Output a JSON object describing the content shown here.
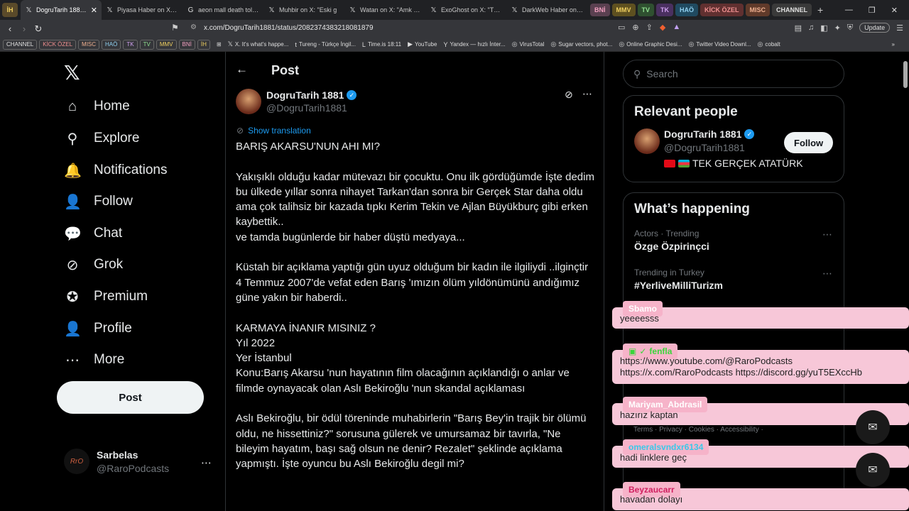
{
  "browser": {
    "tab_folder_left": "İH",
    "tabs": [
      {
        "icon": "𝕏",
        "title": "DogruTarih 1881 on X",
        "active": true
      },
      {
        "icon": "𝕏",
        "title": "Piyasa Haber on X: \"Jap",
        "active": false
      },
      {
        "icon": "G",
        "title": "aeon mall death toll - G",
        "active": false
      },
      {
        "icon": "𝕏",
        "title": "Muhbir on X: \"Eski g",
        "active": false
      },
      {
        "icon": "𝕏",
        "title": "Watan on X: \"Amk bu s",
        "active": false
      },
      {
        "icon": "𝕏",
        "title": "ExoGhost on X: \"The ne",
        "active": false
      },
      {
        "icon": "𝕏",
        "title": "DarkWeb Haber on X: \"",
        "active": false
      }
    ],
    "tab_groups": [
      {
        "label": "BNİ",
        "bg": "#5a4050",
        "fg": "#f3a0c0"
      },
      {
        "label": "MMV",
        "bg": "#5e5020",
        "fg": "#f0d060"
      },
      {
        "label": "TV",
        "bg": "#2f5030",
        "fg": "#90e090"
      },
      {
        "label": "TK",
        "bg": "#4a3060",
        "fg": "#d0a0f0"
      },
      {
        "label": "HAÖ",
        "bg": "#204a60",
        "fg": "#90d0f0"
      },
      {
        "label": "KİCK ÖZEL",
        "bg": "#603030",
        "fg": "#f09090"
      },
      {
        "label": "MISC",
        "bg": "#603a2a",
        "fg": "#f0b090"
      },
      {
        "label": "CHANNEL",
        "bg": "#3a3a3a",
        "fg": "#e0e0e0"
      }
    ],
    "new_tab": "+",
    "window_controls": [
      "—",
      "❐",
      "✕"
    ],
    "url": "x.com/DogruTarih1881/status/2082374383218081879",
    "update_label": "Update",
    "bookmark_folders": [
      {
        "label": "CHANNEL",
        "fg": "#e0e0e0"
      },
      {
        "label": "KİCK ÖZEL",
        "fg": "#f09090"
      },
      {
        "label": "MISC",
        "fg": "#f0b090"
      },
      {
        "label": "HAÖ",
        "fg": "#90d0f0"
      },
      {
        "label": "TK",
        "fg": "#d0a0f0"
      },
      {
        "label": "TV",
        "fg": "#90e090"
      },
      {
        "label": "MMV",
        "fg": "#f0d060"
      },
      {
        "label": "BNİ",
        "fg": "#f3a0c0"
      },
      {
        "label": "İH",
        "fg": "#f0d060"
      }
    ],
    "bookmarks": [
      {
        "icon": "𝕏",
        "label": "X. It's what's happe..."
      },
      {
        "icon": "t",
        "label": "Tureng - Türkçe İngil..."
      },
      {
        "icon": "L",
        "label": "Time.is 18:11"
      },
      {
        "icon": "▶",
        "label": "YouTube"
      },
      {
        "icon": "Y",
        "label": "Yandex — hızlı İnter..."
      },
      {
        "icon": "◎",
        "label": "VirusTotal"
      },
      {
        "icon": "◎",
        "label": "Sugar vectors, phot..."
      },
      {
        "icon": "◎",
        "label": "Online Graphic Desi..."
      },
      {
        "icon": "◎",
        "label": "Twitter Video Downl..."
      },
      {
        "icon": "◎",
        "label": "cobalt"
      }
    ]
  },
  "nav": {
    "items": [
      {
        "icon": "⌂",
        "label": "Home"
      },
      {
        "icon": "⚲",
        "label": "Explore"
      },
      {
        "icon": "🔔",
        "label": "Notifications"
      },
      {
        "icon": "👤",
        "label": "Follow"
      },
      {
        "icon": "💬",
        "label": "Chat"
      },
      {
        "icon": "⊘",
        "label": "Grok"
      },
      {
        "icon": "✪",
        "label": "Premium"
      },
      {
        "icon": "👤",
        "label": "Profile"
      },
      {
        "icon": "⋯",
        "label": "More"
      }
    ],
    "post_button": "Post",
    "account": {
      "name": "Sarbelas",
      "handle": "@RaroPodcasts",
      "avatar_text": "RrO"
    }
  },
  "post": {
    "header": "Post",
    "author": {
      "name": "DogruTarih 1881",
      "handle": "@DogruTarih1881"
    },
    "show_translation": "Show translation",
    "paragraphs": [
      "BARIŞ AKARSU'NUN AHI MI?",
      "Yakışıklı  olduğu  kadar mütevazı bir çocuktu. Onu ilk gördüğümde İşte dedim bu ülkede yıllar sonra nihayet Tarkan'dan sonra bir Gerçek  Star daha oldu ama çok talihsiz  bir kazada tıpkı  Kerim Tekin ve Ajlan Büyükburç  gibi erken kaybettik..\nve tamda bugünlerde bir haber düştü  medyaya...",
      "Küstah  bir açıklama  yaptığı gün  uyuz olduğum  bir kadın ile ilgiliydi ..ilginçtir 4 Temmuz  2007'de vefat eden Barış 'ımızın ölüm  yıldönümünü andığımız güne yakın  bir haberdi..",
      "KARMAYA İNANIR MISINIZ ?\nYıl 2022\nYer İstanbul\nKonu:Barış Akarsu 'nun hayatının  film olacağının açıklandığı  o anlar ve filmde oynayacak olan Aslı Bekiroğlu 'nun skandal  açıklaması",
      "Aslı Bekiroğlu, bir ödül töreninde muhabirlerin \"Barış Bey'in trajik bir ölümü oldu, ne hissettiniz?\" sorusuna gülerek ve umursamaz bir tavırla, \"Ne bileyim hayatım, başı sağ olsun ne denir? Rezalet\" şeklinde açıklama yapmıştı. İşte    oyuncu bu Aslı  Bekiroğlu  degil mi?"
    ]
  },
  "sidebar": {
    "search_placeholder": "Search",
    "relevant_title": "Relevant people",
    "relevant": {
      "name": "DogruTarih 1881",
      "handle": "@DogruTarih1881",
      "bio": "TEK GERÇEK ATATÜRK",
      "follow_label": "Follow"
    },
    "happening_title": "What’s happening",
    "trends": [
      {
        "meta": "Actors · Trending",
        "name": "Özge Özpirinçci"
      },
      {
        "meta": "Trending in Turkey",
        "name": "#YerliveMilliTurizm"
      }
    ],
    "footer": "Terms · Privacy · Cookies · Accessibility ·"
  },
  "chat": [
    {
      "user": "Sbamo",
      "user_color": "#ffffff",
      "text": "yeeeesss"
    },
    {
      "user": "fenfla",
      "user_color": "#3ad63a",
      "text": "https://www.youtube.com/@RaroPodcasts",
      "text2": "https://x.com/RaroPodcasts https://discord.gg/yuT5EXccHb"
    },
    {
      "user": "Mariyam_Abdrasil",
      "user_color": "#ffffff",
      "text": "hazırız kaptan"
    },
    {
      "user": "omeralsvndxr6134",
      "user_color": "#3ac8e8",
      "text": "hadi linklere geç"
    },
    {
      "user": "Beyzaucarr",
      "user_color": "#d02060",
      "text": "havadan dolayı"
    }
  ]
}
